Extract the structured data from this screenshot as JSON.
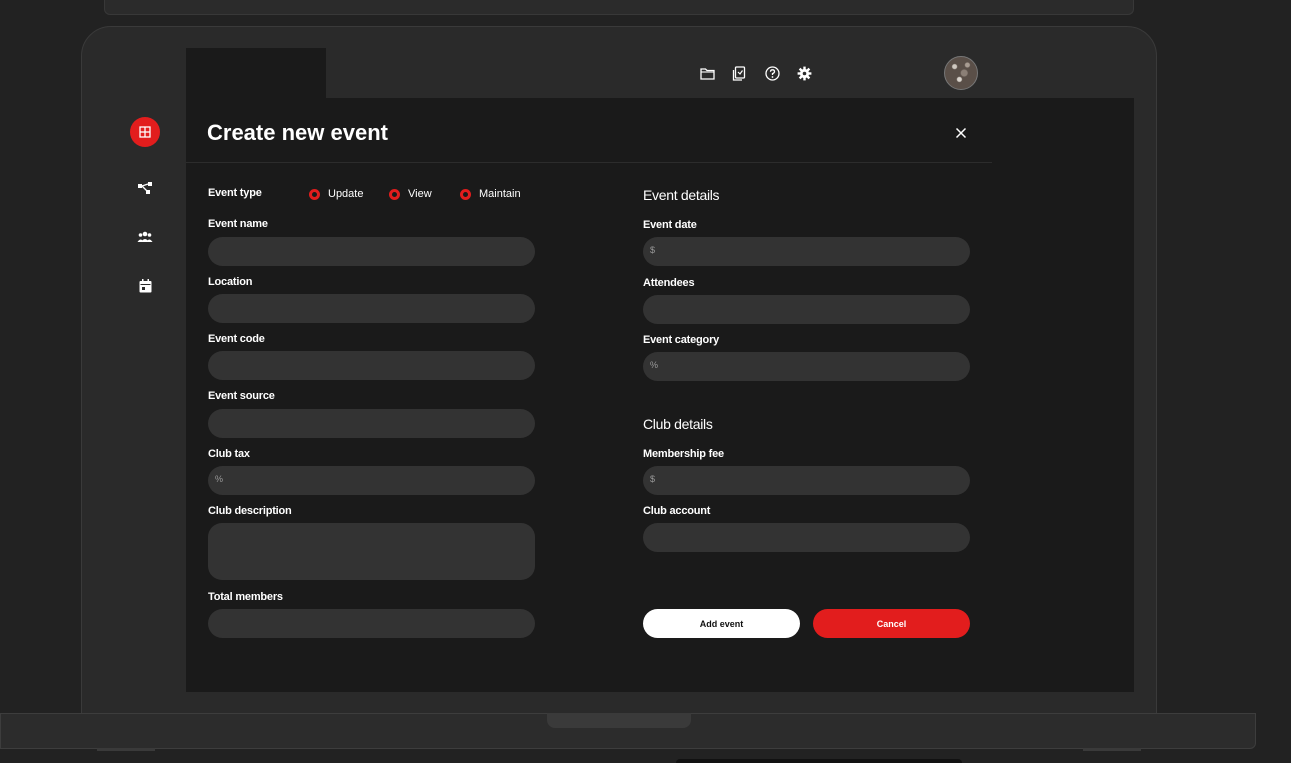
{
  "modal": {
    "title": "Create new event",
    "event_type_label": "Event type",
    "event_type_options": [
      "Update",
      "View",
      "Maintain"
    ]
  },
  "left_form": {
    "event_name": "Event name",
    "location": "Location",
    "event_code": "Event code",
    "event_source": "Event source",
    "club_tax": "Club tax",
    "club_tax_prefix": "%",
    "club_description": "Club description",
    "total_members": "Total members"
  },
  "right_form": {
    "event_details_heading": "Event details",
    "event_date": "Event date",
    "event_date_prefix": "$",
    "attendees": "Attendees",
    "event_category": "Event category",
    "event_category_prefix": "%",
    "club_details_heading": "Club details",
    "membership_fee": "Membership fee",
    "membership_fee_prefix": "$",
    "club_account": "Club account"
  },
  "actions": {
    "add_label": "Add event",
    "cancel_label": "Cancel"
  },
  "sidebar": {
    "items": [
      "dashboard-icon",
      "flow-icon",
      "users-icon",
      "calendar-icon"
    ]
  },
  "topbar": {
    "icons": [
      "folder-icon",
      "clipboard-icon",
      "help-icon",
      "gear-icon",
      "avatar"
    ]
  },
  "colors": {
    "accent": "#e21d1d",
    "background": "#1a1a1a",
    "panel": "#2a2a2a",
    "field": "#333333"
  }
}
